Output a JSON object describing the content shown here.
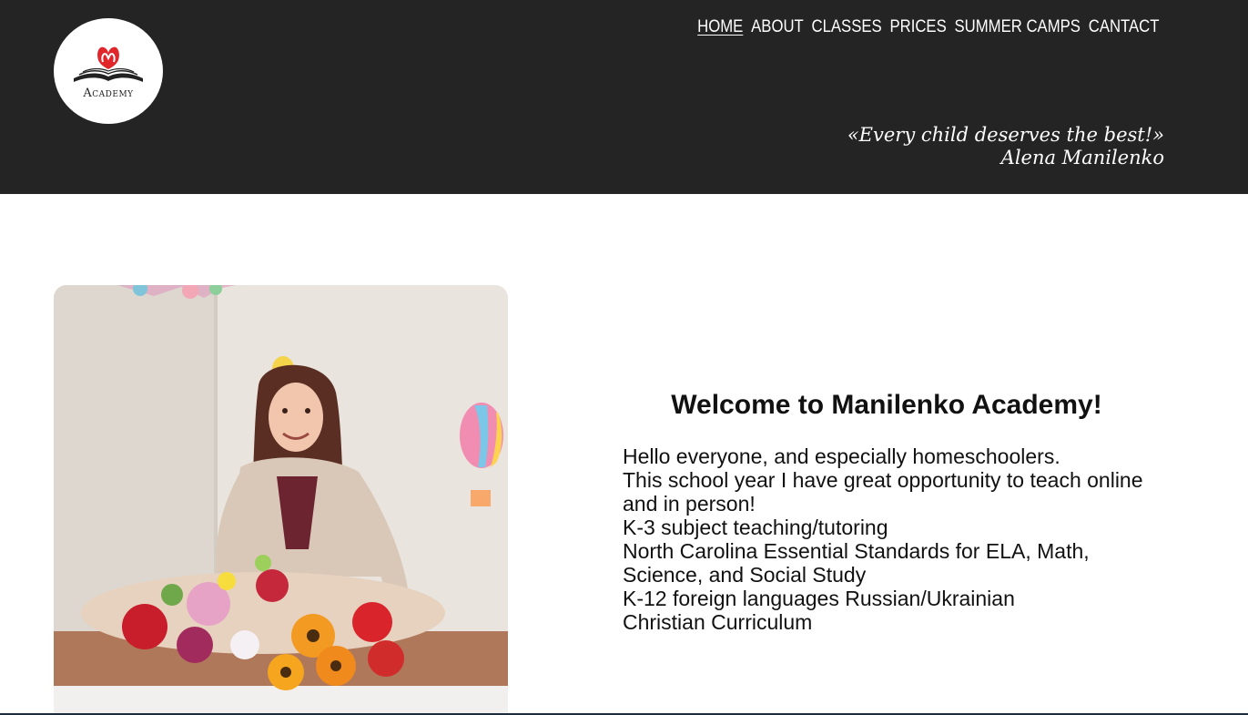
{
  "header": {
    "logo_text": "Academy",
    "nav": [
      {
        "label": "HOME",
        "active": true
      },
      {
        "label": "ABOUT",
        "active": false
      },
      {
        "label": "CLASSES",
        "active": false
      },
      {
        "label": "PRICES",
        "active": false
      },
      {
        "label": "SUMMER CAMPS",
        "active": false
      },
      {
        "label": "CANTACT",
        "active": false
      }
    ],
    "quote": "«Every child deserves the best!»",
    "quote_author": "Alena Manilenko"
  },
  "main": {
    "title": "Welcome to Manilenko Academy!",
    "paragraphs": [
      "Hello everyone, and especially homeschoolers.",
      "This school year I have great opportunity to teach online and in person!",
      "K-3 subject teaching/tutoring",
      "North Carolina Essential Standards for ELA, Math, Science, and Social Study",
      "K-12 foreign languages Russian/Ukrainian",
      "Christian Curriculum"
    ]
  },
  "colors": {
    "header_bg": "#242424",
    "logo_heart": "#e0262b",
    "text": "#111111"
  }
}
